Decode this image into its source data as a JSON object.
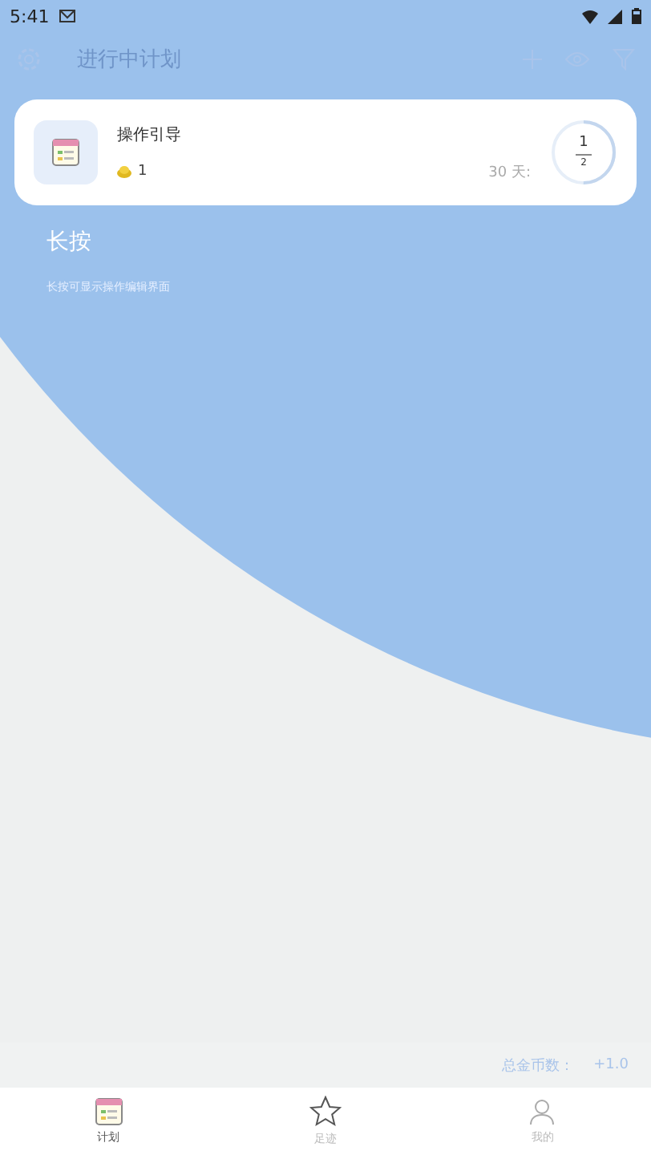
{
  "status_bar": {
    "time": "5:41"
  },
  "toolbar": {
    "title": "进行中计划"
  },
  "plan_card": {
    "title": "操作引导",
    "coins": "1",
    "days": "30 天:",
    "progress_done": "1",
    "progress_total": "2",
    "level": 0.5
  },
  "guide": {
    "title": "长按",
    "text": "长按可显示操作编辑界面"
  },
  "coin_bar": {
    "label": "总金币数：",
    "value": "+1.0"
  },
  "nav": [
    {
      "label": "计划",
      "kind": "calendar",
      "selected": true
    },
    {
      "label": "足迹",
      "kind": "star",
      "selected": false
    },
    {
      "label": "我的",
      "kind": "person",
      "selected": false
    }
  ]
}
